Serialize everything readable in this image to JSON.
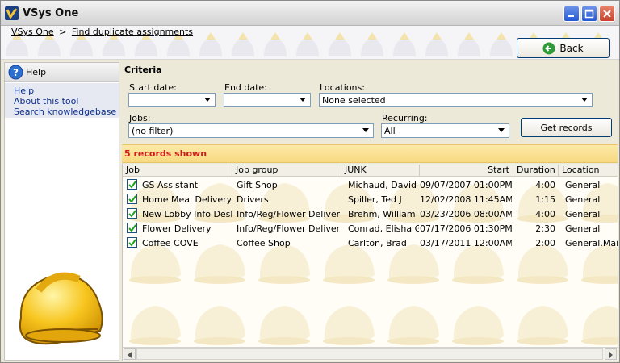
{
  "window": {
    "title": "VSys One"
  },
  "breadcrumb": {
    "root": "VSys One",
    "separator": ">",
    "current": "Find duplicate assignments"
  },
  "back_button": {
    "label": "Back",
    "icon": "back-arrow-icon"
  },
  "sidebar": {
    "header": "Help",
    "links": [
      "Help",
      "About this tool",
      "Search knowledgebase"
    ]
  },
  "criteria": {
    "title": "Criteria",
    "start_date": {
      "label": "Start date:",
      "value": ""
    },
    "end_date": {
      "label": "End date:",
      "value": ""
    },
    "locations": {
      "label": "Locations:",
      "value": "None selected"
    },
    "jobs": {
      "label": "Jobs:",
      "value": "(no filter)"
    },
    "recurring": {
      "label": "Recurring:",
      "value": "All"
    },
    "get_records_label": "Get records"
  },
  "status": {
    "text": "5 records shown",
    "color": "#d21a1a"
  },
  "grid": {
    "columns": [
      "Job",
      "Job group",
      "JUNK",
      "Start",
      "Duration",
      "Location"
    ],
    "rows": [
      {
        "job": "GS Assistant",
        "group": "Gift Shop",
        "junk": "Michaud, David J",
        "start": "09/07/2007 01:00PM",
        "duration": "4:00",
        "location": "General"
      },
      {
        "job": "Home Meal Delivery",
        "group": "Drivers",
        "junk": "Spiller, Ted J",
        "start": "12/02/2008 11:45AM",
        "duration": "1:15",
        "location": "General"
      },
      {
        "job": "New Lobby Info Desk",
        "group": "Info/Reg/Flower Delivery",
        "junk": "Brehm, William B",
        "start": "03/23/2006 08:00AM",
        "duration": "4:00",
        "location": "General"
      },
      {
        "job": "Flower Delivery",
        "group": "Info/Reg/Flower Delivery",
        "junk": "Conrad, Elisha G",
        "start": "07/17/2006 01:30PM",
        "duration": "2:30",
        "location": "General"
      },
      {
        "job": "Coffee COVE",
        "group": "Coffee Shop",
        "junk": "Carlton, Brad",
        "start": "03/17/2011 12:00AM",
        "duration": "2:00",
        "location": "General.Main"
      }
    ]
  }
}
